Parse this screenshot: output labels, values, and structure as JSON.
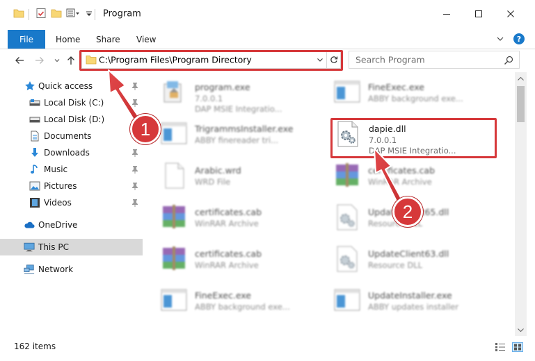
{
  "window": {
    "title": "Program"
  },
  "ribbon": {
    "tabs": [
      "File",
      "Home",
      "Share",
      "View"
    ]
  },
  "address": {
    "path": "C:\\Program Files\\Program Directory"
  },
  "search": {
    "placeholder": "Search Program"
  },
  "nav": {
    "items": [
      {
        "label": "Quick access",
        "icon": "star-icon"
      },
      {
        "label": "Local Disk (C:)",
        "icon": "drive-icon"
      },
      {
        "label": "Local Disk (D:)",
        "icon": "drive-icon"
      },
      {
        "label": "Documents",
        "icon": "documents-icon"
      },
      {
        "label": "Downloads",
        "icon": "download-icon"
      },
      {
        "label": "Music",
        "icon": "music-icon"
      },
      {
        "label": "Pictures",
        "icon": "pictures-icon"
      },
      {
        "label": "Videos",
        "icon": "videos-icon"
      },
      {
        "label": "OneDrive",
        "icon": "cloud-icon"
      },
      {
        "label": "This PC",
        "icon": "computer-icon"
      },
      {
        "label": "Network",
        "icon": "network-icon"
      }
    ]
  },
  "files": [
    {
      "name": "program.exe",
      "sub1": "7.0.0.1",
      "sub2": "DAP MSIE Integratio...",
      "icon": "exe-icon"
    },
    {
      "name": "FineExec.exe",
      "sub1": "ABBY background exe...",
      "sub2": "",
      "icon": "app-window-icon"
    },
    {
      "name": "TrigrammsInstaller.exe",
      "sub1": "ABBY finereader tri...",
      "sub2": "",
      "icon": "app-window-icon"
    },
    {
      "name": "dapie.dll",
      "sub1": "7.0.0.1",
      "sub2": "DAP MSIE Integratio...",
      "icon": "dll-gear-icon"
    },
    {
      "name": "Arabic.wrd",
      "sub1": "WRD File",
      "sub2": "",
      "icon": "blank-file-icon"
    },
    {
      "name": "certificates.cab",
      "sub1": "WinRAR Archive",
      "sub2": "",
      "icon": "winrar-icon"
    },
    {
      "name": "certificates.cab",
      "sub1": "WinRAR Archive",
      "sub2": "",
      "icon": "winrar-icon"
    },
    {
      "name": "UpdateClient65.dll",
      "sub1": "Resource DLL",
      "sub2": "",
      "icon": "dll-gear-icon"
    },
    {
      "name": "certificates.cab",
      "sub1": "WinRAR Archive",
      "sub2": "",
      "icon": "winrar-icon"
    },
    {
      "name": "UpdateClient63.dll",
      "sub1": "Resource DLL",
      "sub2": "",
      "icon": "dll-gear-icon"
    },
    {
      "name": "FineExec.exe",
      "sub1": "ABBY background exe...",
      "sub2": "",
      "icon": "app-window-icon"
    },
    {
      "name": "UpdateInstaller.exe",
      "sub1": "ABBY updates installer",
      "sub2": "",
      "icon": "app-window-icon"
    }
  ],
  "status": {
    "item_count": "162 items"
  },
  "callouts": [
    "1",
    "2"
  ],
  "colors": {
    "accent": "#1979ca",
    "highlight": "#d6383a",
    "selection": "#cce8ff"
  }
}
